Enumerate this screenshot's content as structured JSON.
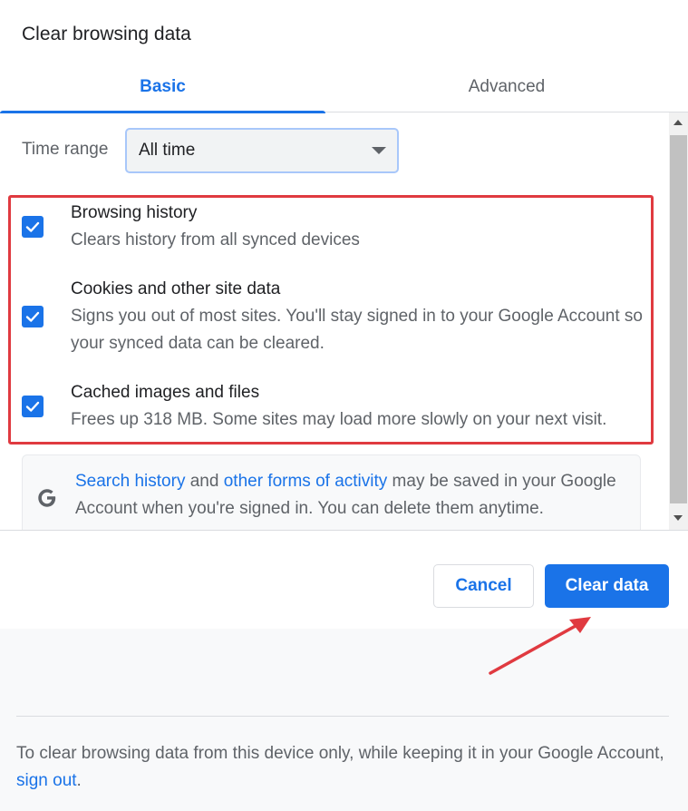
{
  "dialog": {
    "title": "Clear browsing data"
  },
  "tabs": [
    {
      "label": "Basic",
      "active": true
    },
    {
      "label": "Advanced",
      "active": false
    }
  ],
  "time_range": {
    "label": "Time range",
    "selected": "All time"
  },
  "options": [
    {
      "title": "Browsing history",
      "description": "Clears history from all synced devices",
      "checked": true
    },
    {
      "title": "Cookies and other site data",
      "description": "Signs you out of most sites. You'll stay signed in to your Google Account so your synced data can be cleared.",
      "checked": true
    },
    {
      "title": "Cached images and files",
      "description": "Frees up 318 MB. Some sites may load more slowly on your next visit.",
      "checked": true
    }
  ],
  "info": {
    "icon": "google-g-icon",
    "link1": "Search history",
    "text1": " and ",
    "link2": "other forms of activity",
    "text2": " may be saved in your Google Account when you're signed in. You can delete them anytime."
  },
  "actions": {
    "cancel_label": "Cancel",
    "clear_label": "Clear data"
  },
  "footer": {
    "text": "To clear browsing data from this device only, while keeping it in your Google Account, ",
    "link": "sign out",
    "suffix": "."
  },
  "colors": {
    "accent": "#1a73e8",
    "annotation_red": "#e03a40"
  }
}
